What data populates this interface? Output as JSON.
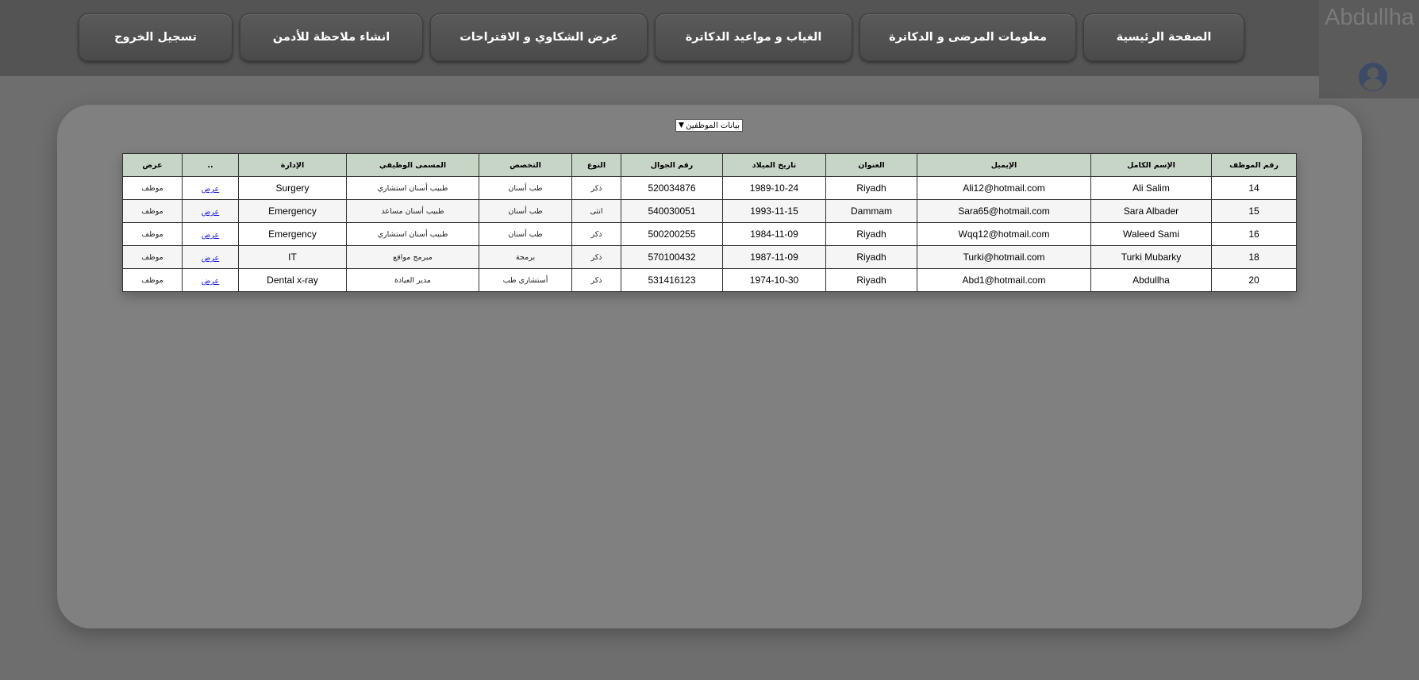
{
  "user": {
    "name": "Abdullha",
    "avatar_icon": "user-circle-icon"
  },
  "nav": {
    "home": "الصفحة الرئيسية",
    "patients_doctors": "معلومات المرضى و الدكاترة",
    "absence_appointments": "الغياب و مواعيد الدكاترة",
    "complaints": "عرض الشكاوي و الاقتراحات",
    "admin_note": "انشاء ملاحظة للأدمن",
    "logout": "تسجيل الخروج"
  },
  "filter": {
    "selected": "بيانات الموظفين"
  },
  "table": {
    "headers": {
      "emp_id": "رقم الموظف",
      "full_name": "الإسم الكامل",
      "email": "الإيميل",
      "address": "العنوان",
      "birth_date": "تاريخ الميلاد",
      "mobile": "رقم الجوال",
      "gender": "النوع",
      "specialty": "التخصص",
      "job_title": "المسمى الوظيفي",
      "department": "الإدارة",
      "dots": "..",
      "view": "عرض"
    },
    "rows": [
      {
        "emp_id": "14",
        "full_name": "Ali Salim",
        "email": "Ali12@hotmail.com",
        "address": "Riyadh",
        "birth_date": "1989-10-24",
        "mobile": "520034876",
        "gender": "ذكر",
        "specialty": "طب أسنان",
        "job_title": "طبيب أسنان استشاري",
        "department": "Surgery",
        "link": "عرض",
        "type": "موظف"
      },
      {
        "emp_id": "15",
        "full_name": "Sara Albader",
        "email": "Sara65@hotmail.com",
        "address": "Dammam",
        "birth_date": "1993-11-15",
        "mobile": "540030051",
        "gender": "انثى",
        "specialty": "طب أسنان",
        "job_title": "طبيب أسنان مساعد",
        "department": "Emergency",
        "link": "عرض",
        "type": "موظف"
      },
      {
        "emp_id": "16",
        "full_name": "Waleed Sami",
        "email": "Wqq12@hotmail.com",
        "address": "Riyadh",
        "birth_date": "1984-11-09",
        "mobile": "500200255",
        "gender": "ذكر",
        "specialty": "طب أسنان",
        "job_title": "طبيب أسنان استشاري",
        "department": "Emergency",
        "link": "عرض",
        "type": "موظف"
      },
      {
        "emp_id": "18",
        "full_name": "Turki Mubarky",
        "email": "Turki@hotmail.com",
        "address": "Riyadh",
        "birth_date": "1987-11-09",
        "mobile": "570100432",
        "gender": "ذكر",
        "specialty": "برمجة",
        "job_title": "مبرمج مواقع",
        "department": "IT",
        "link": "عرض",
        "type": "موظف"
      },
      {
        "emp_id": "20",
        "full_name": "Abdullha",
        "email": "Abd1@hotmail.com",
        "address": "Riyadh",
        "birth_date": "1974-10-30",
        "mobile": "531416123",
        "gender": "ذكر",
        "specialty": "أستشاري طب",
        "job_title": "مدير العيادة",
        "department": "Dental x-ray",
        "link": "عرض",
        "type": "موظف"
      }
    ]
  }
}
